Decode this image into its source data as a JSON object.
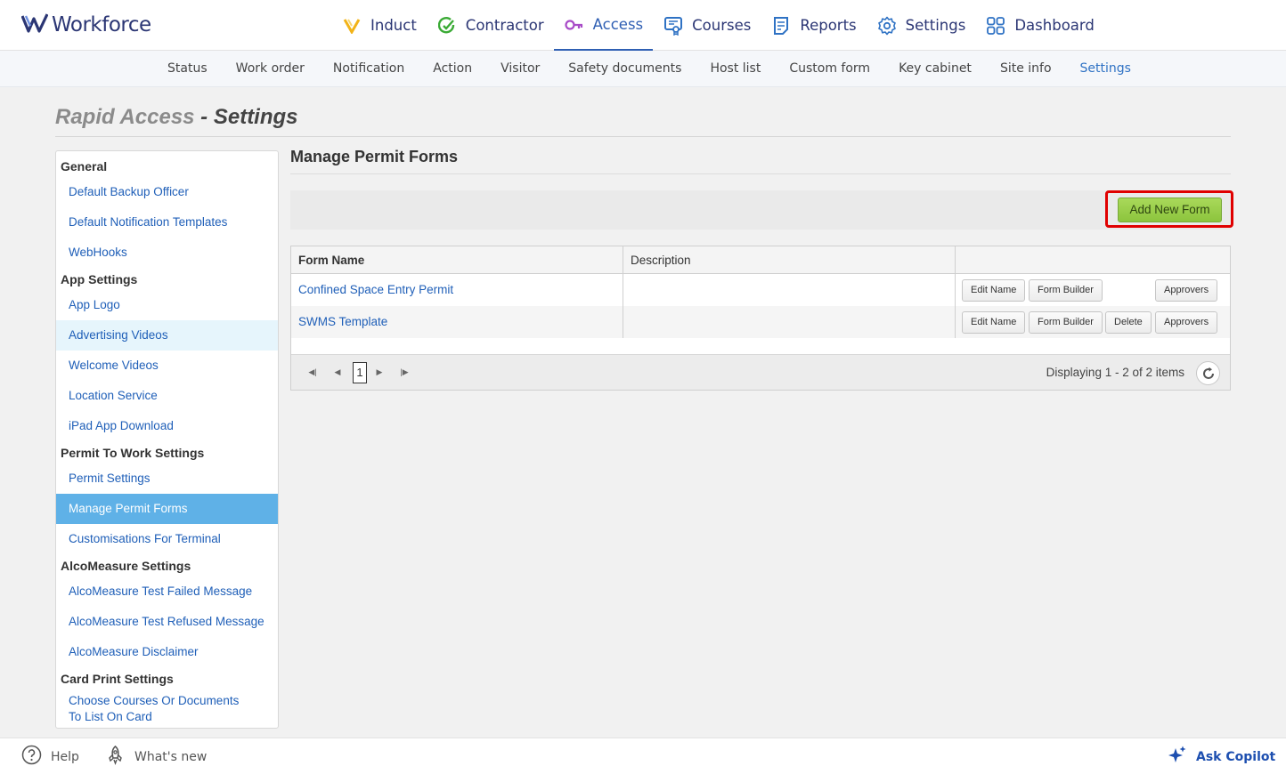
{
  "brand": {
    "name": "Workforce"
  },
  "main_nav": [
    {
      "label": "Induct",
      "icon": "induct-v-icon"
    },
    {
      "label": "Contractor",
      "icon": "contractor-check-icon"
    },
    {
      "label": "Access",
      "icon": "key-icon",
      "active": true
    },
    {
      "label": "Courses",
      "icon": "certificate-icon"
    },
    {
      "label": "Reports",
      "icon": "report-document-icon"
    },
    {
      "label": "Settings",
      "icon": "gear-icon"
    },
    {
      "label": "Dashboard",
      "icon": "dashboard-grid-icon"
    }
  ],
  "sub_nav": [
    "Status",
    "Work order",
    "Notification",
    "Action",
    "Visitor",
    "Safety documents",
    "Host list",
    "Custom form",
    "Key cabinet",
    "Site info",
    "Settings"
  ],
  "sub_nav_active": "Settings",
  "page_title": {
    "part1": "Rapid Access",
    "separator": " - ",
    "part2": "Settings"
  },
  "sidebar": {
    "groups": [
      {
        "title": "General",
        "items": [
          "Default Backup Officer",
          "Default Notification Templates",
          "WebHooks"
        ]
      },
      {
        "title": "App Settings",
        "items": [
          "App Logo",
          "Advertising Videos",
          "Welcome Videos",
          "Location Service",
          "iPad App Download"
        ]
      },
      {
        "title": "Permit To Work Settings",
        "items": [
          "Permit Settings",
          "Manage Permit Forms",
          "Customisations For Terminal"
        ]
      },
      {
        "title": "AlcoMeasure Settings",
        "items": [
          "AlcoMeasure Test Failed Message",
          "AlcoMeasure Test Refused Message",
          "AlcoMeasure Disclaimer"
        ]
      },
      {
        "title": "Card Print Settings",
        "items": [
          "Choose Courses Or Documents To List On Card"
        ]
      }
    ],
    "selected": "Manage Permit Forms",
    "hovered": "Advertising Videos"
  },
  "content": {
    "title": "Manage Permit Forms",
    "add_button": "Add New Form",
    "columns": [
      "Form Name",
      "Description",
      ""
    ],
    "rows": [
      {
        "name": "Confined Space Entry Permit",
        "description": "",
        "actions": [
          "Edit Name",
          "Form Builder",
          "Approvers"
        ]
      },
      {
        "name": "SWMS Template",
        "description": "",
        "actions": [
          "Edit Name",
          "Form Builder",
          "Delete",
          "Approvers"
        ]
      }
    ],
    "pager": {
      "current_page": "1",
      "info": "Displaying 1 - 2 of 2 items"
    }
  },
  "footer": {
    "help": "Help",
    "whats_new": "What's new",
    "copilot": "Ask Copilot"
  },
  "colors": {
    "brand": "#2b3674",
    "accent": "#2f72c4",
    "selected": "#5fb1e7",
    "add_button": "#9ccf4b",
    "highlight": "#e00000"
  }
}
